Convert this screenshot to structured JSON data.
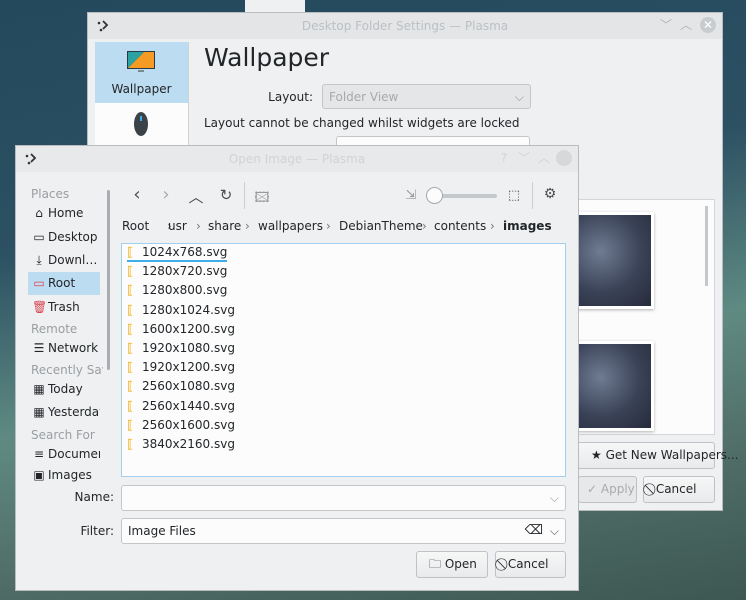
{
  "back_window": {
    "title": "Desktop Folder Settings — Plasma",
    "sidebar": [
      {
        "label": "Wallpaper",
        "icon": "monitor-icon",
        "selected": true
      },
      {
        "label": "",
        "icon": "mouse-icon"
      }
    ],
    "heading": "Wallpaper",
    "layout_label": "Layout:",
    "layout_value": "Folder View",
    "lock_note": "Layout cannot be changed whilst widgets are locked",
    "get_new_label": "Get New Wallpapers...",
    "apply_label": "Apply",
    "cancel_label": "Cancel"
  },
  "dialog": {
    "title": "Open Image — Plasma",
    "places": {
      "sections": [
        "Places",
        "Remote",
        "Recently Saved",
        "Search For"
      ],
      "items": [
        {
          "label": "Home",
          "icon": "home-icon"
        },
        {
          "label": "Desktop",
          "icon": "desktop-icon"
        },
        {
          "label": "Downloads",
          "icon": "download-icon"
        },
        {
          "label": "Root",
          "icon": "folder-red-icon",
          "selected": true
        },
        {
          "label": "Trash",
          "icon": "trash-icon"
        },
        {
          "label": "Network",
          "icon": "network-icon"
        },
        {
          "label": "Today",
          "icon": "calendar-icon"
        },
        {
          "label": "Yesterday",
          "icon": "calendar-icon"
        },
        {
          "label": "Documents",
          "icon": "document-icon"
        },
        {
          "label": "Images",
          "icon": "image-icon"
        }
      ]
    },
    "breadcrumb": [
      "Root",
      "usr",
      "share",
      "wallpapers",
      "DebianTheme",
      "contents",
      "images"
    ],
    "files": [
      "1024x768.svg",
      "1280x720.svg",
      "1280x800.svg",
      "1280x1024.svg",
      "1600x1200.svg",
      "1920x1080.svg",
      "1920x1200.svg",
      "2560x1080.svg",
      "2560x1440.svg",
      "2560x1600.svg",
      "3840x2160.svg"
    ],
    "name_label": "Name:",
    "name_value": "",
    "filter_label": "Filter:",
    "filter_value": "Image Files",
    "open_label": "Open",
    "cancel_label": "Cancel",
    "zoom_level": 0
  },
  "colors": {
    "selection": "#bcdcf2",
    "accent": "#3daee9",
    "svg_icon": "#f3b11a"
  }
}
